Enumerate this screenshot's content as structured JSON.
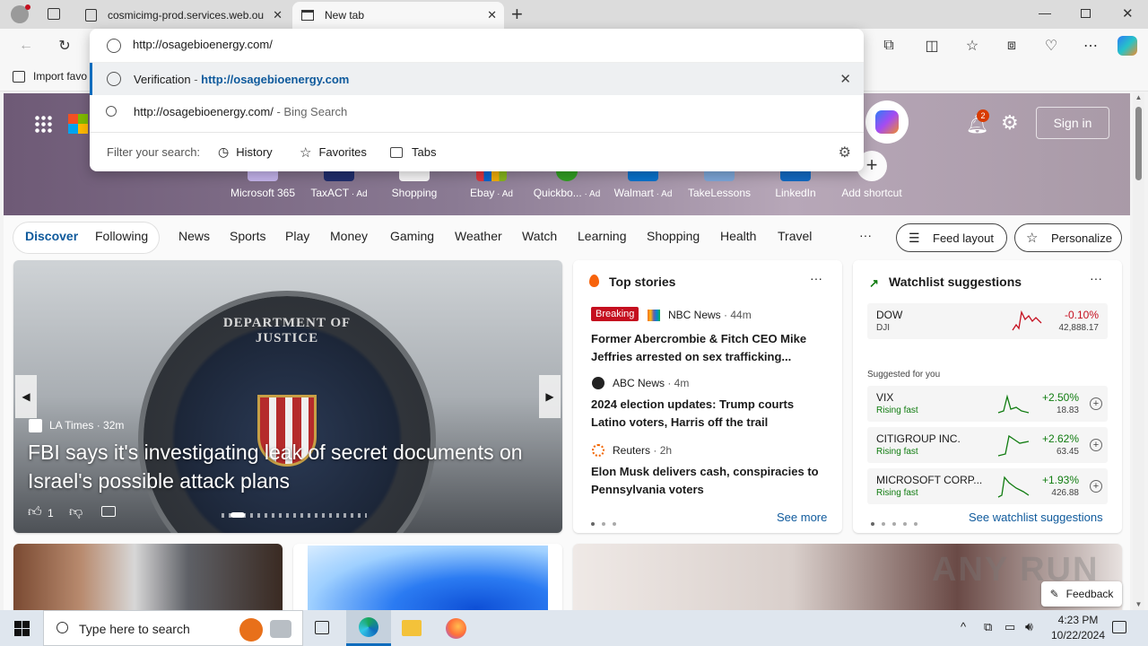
{
  "tabs": [
    {
      "title": "cosmicimg-prod.services.web.ou"
    },
    {
      "title": "New tab"
    }
  ],
  "address": {
    "value": "http://osagebioenergy.com/"
  },
  "favbar": {
    "import_label": "Import favo"
  },
  "omnibox": {
    "suggestion1_title": "Verification",
    "suggestion1_sep": " - ",
    "suggestion1_url": "http://osagebioenergy.com",
    "suggestion2_text": "http://osagebioenergy.com/",
    "suggestion2_suffix": " - Bing Search",
    "filter_label": "Filter your search:",
    "filters": [
      "History",
      "Favorites",
      "Tabs"
    ]
  },
  "header": {
    "notif_count": "2",
    "signin": "Sign in"
  },
  "shortcuts": [
    {
      "label": "Microsoft 365",
      "ad": ""
    },
    {
      "label": "TaxACT",
      "ad": " · Ad"
    },
    {
      "label": "Shopping",
      "ad": ""
    },
    {
      "label": "Ebay",
      "ad": " · Ad"
    },
    {
      "label": "Quickbo...",
      "ad": " · Ad"
    },
    {
      "label": "Walmart",
      "ad": " · Ad"
    },
    {
      "label": "TakeLessons",
      "ad": ""
    },
    {
      "label": "LinkedIn",
      "ad": ""
    },
    {
      "label": "Add shortcut",
      "ad": ""
    }
  ],
  "nav": {
    "discover": "Discover",
    "following": "Following",
    "items": [
      "News",
      "Sports",
      "Play",
      "Money",
      "Gaming",
      "Weather",
      "Watch",
      "Learning",
      "Shopping",
      "Health",
      "Travel"
    ],
    "more": "···",
    "feed_layout": "Feed layout",
    "personalize": "Personalize"
  },
  "hero_story": {
    "source": "LA Times",
    "time": " · 32m",
    "title": "FBI says it's investigating leak of secret documents on Israel's possible attack plans",
    "likes": "1",
    "seal_text": "DEPARTMENT OF JUSTICE"
  },
  "top_stories": {
    "heading": "Top stories",
    "items": [
      {
        "badge": "Breaking",
        "source": "NBC News",
        "time": " · 44m",
        "title": "Former Abercrombie & Fitch CEO Mike Jeffries arrested on sex trafficking..."
      },
      {
        "badge": "",
        "source": "ABC News",
        "time": " · 4m",
        "title": "2024 election updates: Trump courts Latino voters, Harris off the trail"
      },
      {
        "badge": "",
        "source": "Reuters",
        "time": " · 2h",
        "title": "Elon Musk delivers cash, conspiracies to Pennsylvania voters"
      }
    ],
    "see_more": "See more"
  },
  "watchlist": {
    "heading": "Watchlist suggestions",
    "main": {
      "name": "DOW",
      "sub": "DJI",
      "pct": "-0.10%",
      "val": "42,888.17"
    },
    "suggested_label": "Suggested for you",
    "items": [
      {
        "name": "VIX",
        "sub": "Rising fast",
        "pct": "+2.50%",
        "val": "18.83"
      },
      {
        "name": "CITIGROUP INC.",
        "sub": "Rising fast",
        "pct": "+2.62%",
        "val": "63.45"
      },
      {
        "name": "MICROSOFT CORP...",
        "sub": "Rising fast",
        "pct": "+1.93%",
        "val": "426.88"
      }
    ],
    "see_all": "See watchlist suggestions"
  },
  "feedback": "Feedback",
  "watermark": "ANY RUN",
  "taskbar": {
    "search_placeholder": "Type here to search",
    "time": "4:23 PM",
    "date": "10/22/2024"
  },
  "colors": {
    "accent": "#0f6cbd",
    "positive": "#107c10",
    "negative": "#c50f1f",
    "breaking": "#c50f1f"
  }
}
